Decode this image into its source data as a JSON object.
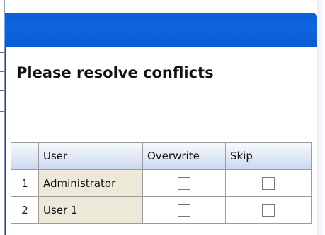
{
  "dialog": {
    "title": "",
    "heading": "Please resolve conflicts"
  },
  "table": {
    "columns": {
      "number": "",
      "user": "User",
      "overwrite": "Overwrite",
      "skip": "Skip"
    },
    "rows": [
      {
        "number": "1",
        "user": "Administrator",
        "overwrite": false,
        "skip": false
      },
      {
        "number": "2",
        "user": "User 1",
        "overwrite": false,
        "skip": false
      }
    ]
  },
  "colors": {
    "title_bar": "#0b5fd6",
    "header_gradient_bottom": "#c9d7ee",
    "user_cell_bg": "#ece9d8"
  }
}
